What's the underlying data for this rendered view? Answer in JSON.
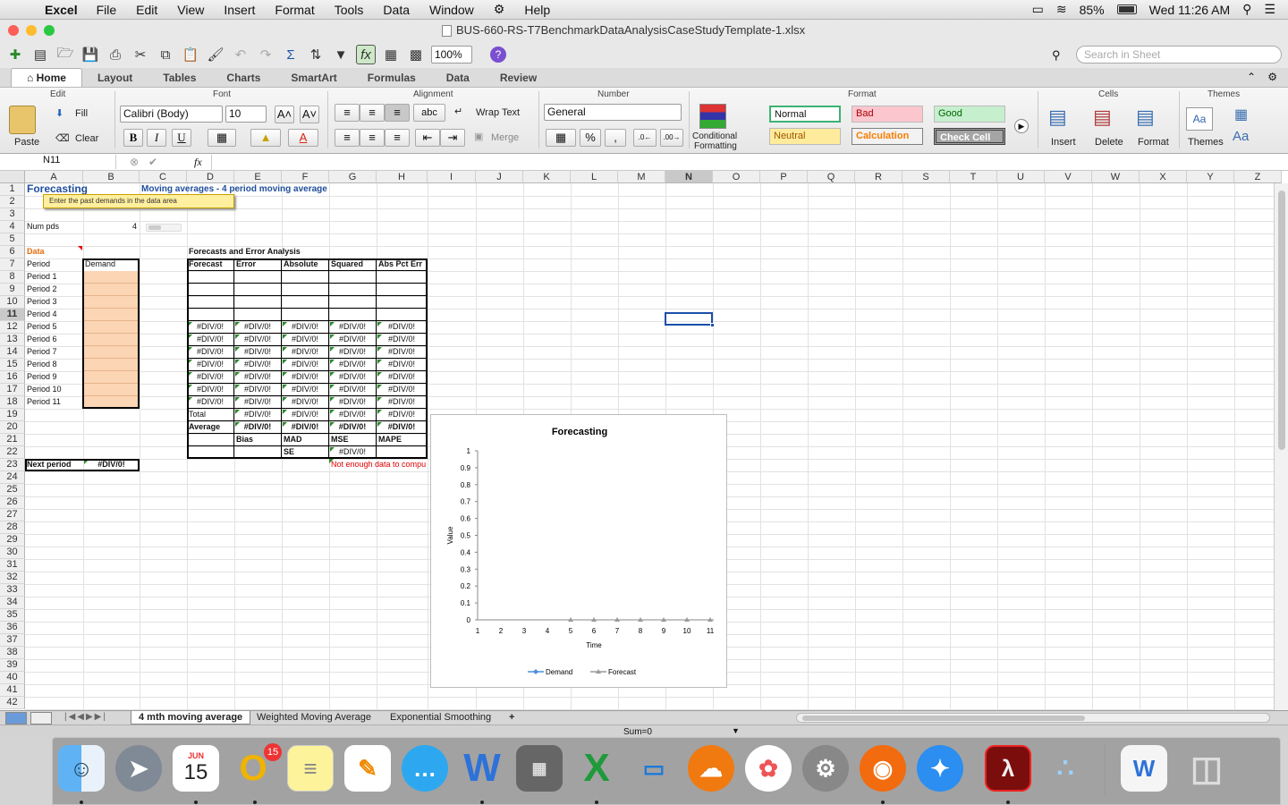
{
  "menubar": {
    "app": "Excel",
    "items": [
      "File",
      "Edit",
      "View",
      "Insert",
      "Format",
      "Tools",
      "Data",
      "Window",
      "Help"
    ],
    "battery": "85%",
    "clock": "Wed 11:26 AM"
  },
  "window": {
    "title": "BUS-660-RS-T7BenchmarkDataAnalysisCaseStudyTemplate-1.xlsx"
  },
  "toolbar": {
    "zoom": "100%",
    "search_placeholder": "Search in Sheet"
  },
  "ribbon_tabs": [
    "Home",
    "Layout",
    "Tables",
    "Charts",
    "SmartArt",
    "Formulas",
    "Data",
    "Review"
  ],
  "ribbon": {
    "groups": {
      "edit": "Edit",
      "font": "Font",
      "alignment": "Alignment",
      "number": "Number",
      "format": "Format",
      "cells": "Cells",
      "themes": "Themes"
    },
    "paste": "Paste",
    "fill": "Fill",
    "clear": "Clear",
    "font_name": "Calibri (Body)",
    "font_size": "10",
    "wrap_text": "Wrap Text",
    "merge": "Merge",
    "abc": "abc",
    "number_format": "General",
    "conditional": "Conditional",
    "formatting": "Formatting",
    "styles": {
      "normal": "Normal",
      "bad": "Bad",
      "good": "Good",
      "neutral": "Neutral",
      "calculation": "Calculation",
      "check_cell": "Check Cell"
    },
    "insert": "Insert",
    "delete": "Delete",
    "format": "Format",
    "themes": "Themes"
  },
  "formula_bar": {
    "name_box": "N11",
    "fx": "fx"
  },
  "columns": [
    "A",
    "B",
    "C",
    "D",
    "E",
    "F",
    "G",
    "H",
    "I",
    "J",
    "K",
    "L",
    "M",
    "N",
    "O",
    "P",
    "Q",
    "R",
    "S",
    "T",
    "U",
    "V",
    "W",
    "X",
    "Y",
    "Z"
  ],
  "sheet": {
    "title": "Forecasting",
    "subtitle": "Moving averages -  4 period moving average",
    "tooltip": "Enter the past demands in the data area",
    "num_pds_label": "Num pds",
    "num_pds_value": "4",
    "data_label": "Data",
    "period_header": "Period",
    "demand_header": "Demand",
    "periods": [
      "Period 1",
      "Period 2",
      "Period 3",
      "Period 4",
      "Period 5",
      "Period 6",
      "Period 7",
      "Period 8",
      "Period 9",
      "Period 10",
      "Period 11"
    ],
    "forecast_section": "Forecasts and Error Analysis",
    "forecast_headers": [
      "Forecast",
      "Error",
      "Absolute",
      "Squared",
      "Abs Pct Err"
    ],
    "error_value": "#DIV/0!",
    "total_label": "Total",
    "average_label": "Average",
    "bias_label": "Bias",
    "mad_label": "MAD",
    "mse_label": "MSE",
    "mape_label": "MAPE",
    "se_label": "SE",
    "next_period_label": "Next period",
    "warning": "Not enough data to compu"
  },
  "chart_data": {
    "type": "line",
    "title": "Forecasting",
    "xlabel": "Time",
    "ylabel": "Value",
    "categories": [
      1,
      2,
      3,
      4,
      5,
      6,
      7,
      8,
      9,
      10,
      11
    ],
    "y_ticks": [
      "0",
      "0.1",
      "0.2",
      "0.3",
      "0.4",
      "0.5",
      "0.6",
      "0.7",
      "0.8",
      "0.9",
      "1"
    ],
    "ylim": [
      0,
      1
    ],
    "series": [
      {
        "name": "Demand",
        "values": [
          null,
          null,
          null,
          null,
          null,
          null,
          null,
          null,
          null,
          null,
          null
        ],
        "color": "#4a90d9"
      },
      {
        "name": "Forecast",
        "values": [
          null,
          null,
          null,
          null,
          0,
          0,
          0,
          0,
          0,
          0,
          0
        ],
        "color": "#9a9a9a"
      }
    ],
    "legend": "bottom"
  },
  "sheet_tabs": [
    "4 mth moving average",
    "Weighted Moving Average",
    "Exponential Smoothing"
  ],
  "status": {
    "sum": "Sum=0"
  },
  "dock": {
    "calendar_month": "JUN",
    "calendar_day": "15",
    "mail_badge": "15"
  }
}
